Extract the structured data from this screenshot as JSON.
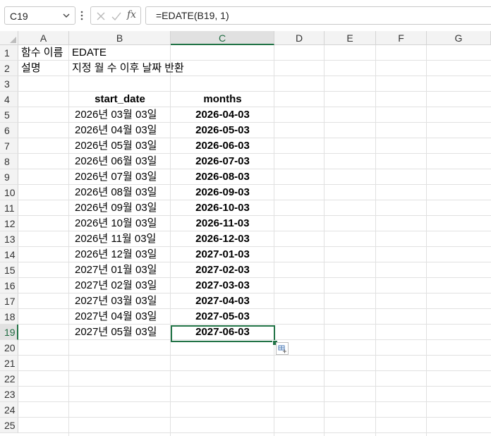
{
  "formula_bar": {
    "name_box": "C19",
    "formula": "=EDATE(B19, 1)",
    "fx_label": "fx"
  },
  "columns": [
    "A",
    "B",
    "C",
    "D",
    "E",
    "F",
    "G"
  ],
  "selected_column": "C",
  "rows": [
    "1",
    "2",
    "3",
    "4",
    "5",
    "6",
    "7",
    "8",
    "9",
    "10",
    "11",
    "12",
    "13",
    "14",
    "15",
    "16",
    "17",
    "18",
    "19",
    "20",
    "21",
    "22",
    "23",
    "24",
    "25"
  ],
  "selected_row": "19",
  "sheet": {
    "a1": "함수 이름",
    "b1": "EDATE",
    "a2": "설명",
    "b2": "지정 월 수 이후 날짜 반환",
    "header_start_date": "start_date",
    "header_months": "months",
    "start_dates": [
      "2026년 03월 03일",
      "2026년 04월 03일",
      "2026년 05월 03일",
      "2026년 06월 03일",
      "2026년 07월 03일",
      "2026년 08월 03일",
      "2026년 09월 03일",
      "2026년 10월 03일",
      "2026년 11월 03일",
      "2026년 12월 03일",
      "2027년 01월 03일",
      "2027년 02월 03일",
      "2027년 03월 03일",
      "2027년 04월 03일",
      "2027년 05월 03일"
    ],
    "months": [
      "2026-04-03",
      "2026-05-03",
      "2026-06-03",
      "2026-07-03",
      "2026-08-03",
      "2026-09-03",
      "2026-10-03",
      "2026-11-03",
      "2026-12-03",
      "2027-01-03",
      "2027-02-03",
      "2027-03-03",
      "2027-04-03",
      "2027-05-03",
      "2027-06-03"
    ]
  },
  "colors": {
    "selection": "#217346",
    "header_bg": "#f3f3f3",
    "gridline": "#e1e1e1"
  }
}
